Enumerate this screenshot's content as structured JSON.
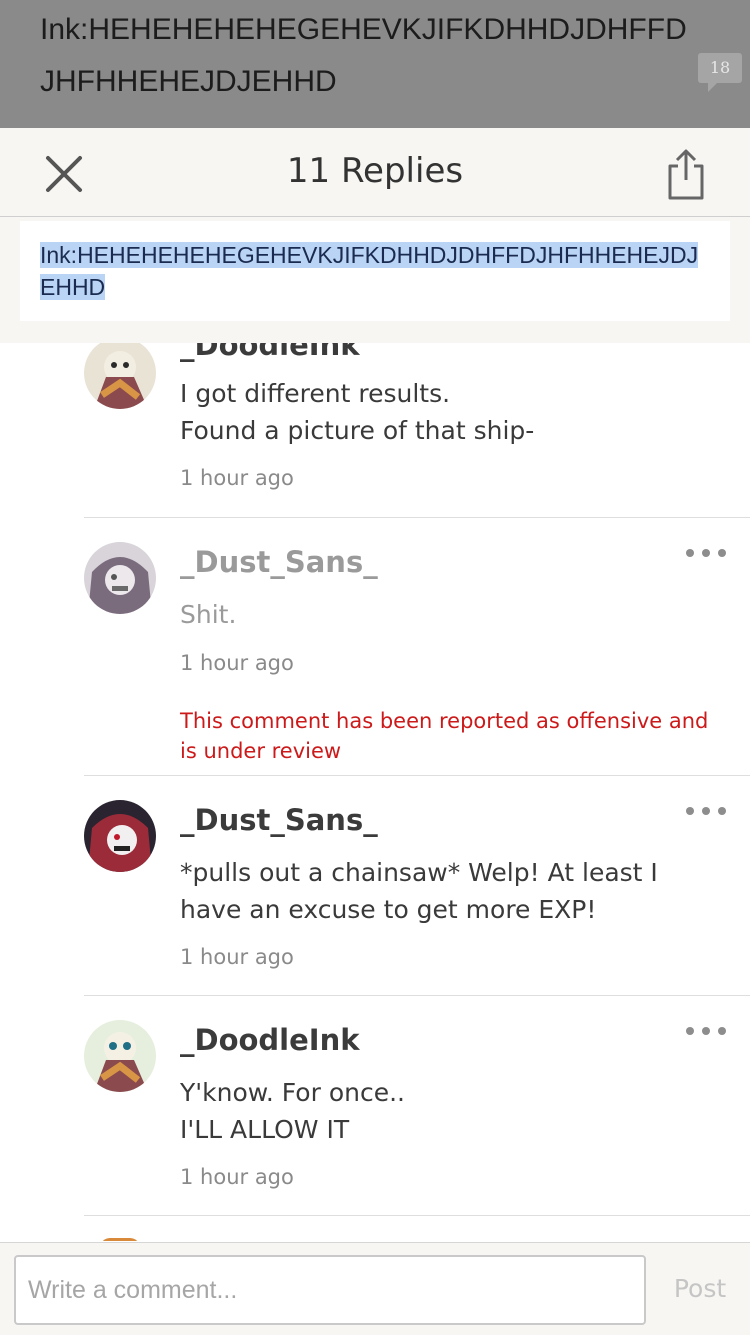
{
  "background_post": {
    "text": "Ink:HEHEHEHEHEGEHEVKJIFKDHHDJDHFFDJHFHHEHEJDJEHHD",
    "badge_count": "18"
  },
  "header": {
    "title": "11 Replies",
    "close_icon": "close-icon",
    "share_icon": "share-icon"
  },
  "parent_comment": {
    "text": "Ink:HEHEHEHEHEGEHEVKJIFKDHHDJDHFFDJHFHHEHEJDJEHHD"
  },
  "comments": [
    {
      "author": "_DoodleInk",
      "lines": [
        "I got different results.",
        "Found a picture of that ship-"
      ],
      "time": "1 hour ago"
    },
    {
      "author": "_Dust_Sans_",
      "lines": [
        "Shit."
      ],
      "time": "1 hour ago",
      "report_notice": "This comment has been reported as offensive and is under review"
    },
    {
      "author": "_Dust_Sans_",
      "lines": [
        "*pulls out a chainsaw* Welp! At least I have an excuse to get more EXP!"
      ],
      "time": "1 hour ago"
    },
    {
      "author": "_DoodleInk",
      "lines": [
        "Y'know. For once..",
        "I'LL ALLOW IT"
      ],
      "time": "1 hour ago"
    }
  ],
  "composer": {
    "placeholder": "Write a comment...",
    "post_label": "Post"
  },
  "colors": {
    "accent_report": "#cc1a1a",
    "selection": "#b9d4f4",
    "sheet_bg": "#f7f6f2"
  }
}
